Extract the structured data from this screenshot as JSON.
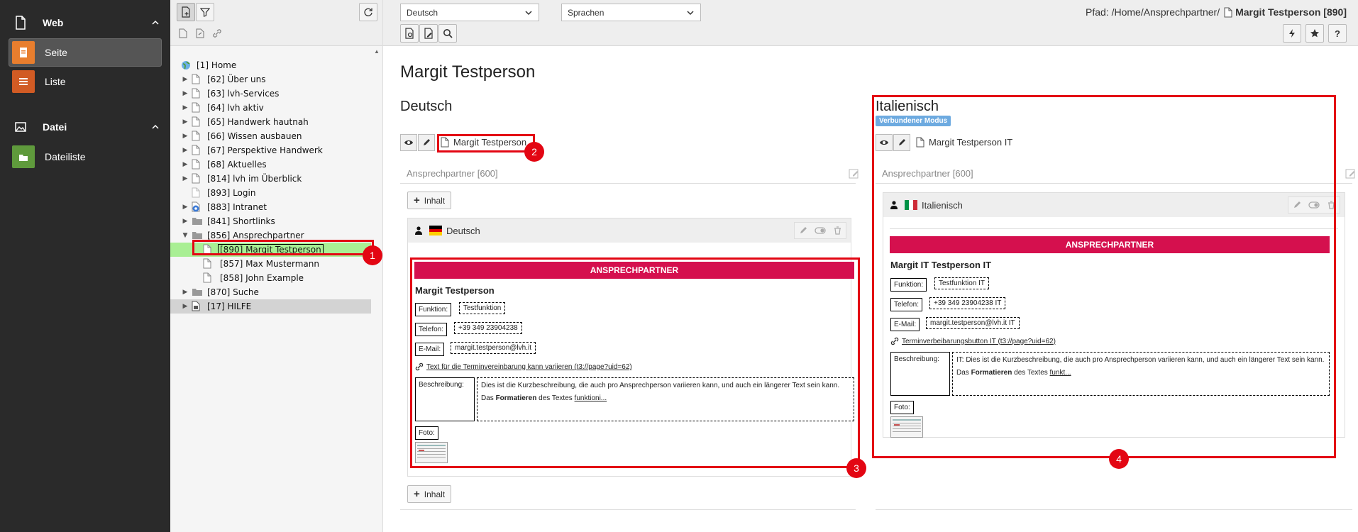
{
  "modules": {
    "groups": [
      {
        "label": "Web",
        "items": [
          "Seite",
          "Liste"
        ]
      },
      {
        "label": "Datei",
        "items": [
          "Dateiliste"
        ]
      }
    ]
  },
  "tree": {
    "nodes": [
      {
        "label": "[1] Home",
        "icon": "globe-icon"
      },
      {
        "label": "[62] Über uns",
        "icon": "page-icon"
      },
      {
        "label": "[63] lvh-Services",
        "icon": "page-icon"
      },
      {
        "label": "[64] lvh aktiv",
        "icon": "page-icon"
      },
      {
        "label": "[65] Handwerk hautnah",
        "icon": "page-icon"
      },
      {
        "label": "[66] Wissen ausbauen",
        "icon": "page-icon"
      },
      {
        "label": "[67] Perspektive Handwerk",
        "icon": "page-icon"
      },
      {
        "label": "[68] Aktuelles",
        "icon": "page-icon"
      },
      {
        "label": "[814] lvh im Überblick",
        "icon": "page-icon"
      },
      {
        "label": "[893] Login",
        "icon": "page-icon"
      },
      {
        "label": "[883] Intranet",
        "icon": "intranet-icon"
      },
      {
        "label": "[841] Shortlinks",
        "icon": "folder-icon"
      },
      {
        "label": "[856] Ansprechpartner",
        "icon": "folder-icon"
      },
      {
        "label": "[890] Margit Testperson",
        "icon": "page-icon"
      },
      {
        "label": "[857] Max Mustermann",
        "icon": "page-icon"
      },
      {
        "label": "[858] John Example",
        "icon": "page-icon"
      },
      {
        "label": "[870] Suche",
        "icon": "folder-icon"
      },
      {
        "label": "[17] HILFE",
        "icon": "help-page-icon"
      }
    ]
  },
  "header": {
    "language_select": "Deutsch",
    "languages_select": "Sprachen",
    "path_label": "Pfad: /Home/Ansprechpartner/",
    "page_title": "Margit Testperson [890]"
  },
  "content": {
    "page_heading": "Margit Testperson",
    "connected_mode_badge": "Verbundener Modus",
    "add_content_label": "Inhalt",
    "columns": [
      {
        "language": "Deutsch",
        "page_title": "Margit Testperson",
        "column_header": "Ansprechpartner [600]",
        "element_label": "Deutsch",
        "banner": "ANSPRECHPARTNER",
        "name": "Margit Testperson",
        "funktion_label": "Funktion:",
        "funktion": "Testfunktion",
        "telefon_label": "Telefon:",
        "telefon": "+39 349 23904238",
        "email_label": "E-Mail:",
        "email": "margit.testperson@lvh.it",
        "link_text": "Text für die Terminvereinbarung kann variieren (t3://page?uid=62)",
        "beschreibung_label": "Beschreibung:",
        "beschreibung": "Dies ist die Kurzbeschreibung, die auch pro Ansprechperson variieren kann, und auch ein längerer Text sein kann.",
        "desc2_a": "Das ",
        "desc2_b": "Formatieren",
        "desc2_c": " des Textes ",
        "desc2_d": "funktioni...",
        "foto_label": "Foto:"
      },
      {
        "language": "Italienisch",
        "page_title": "Margit Testperson IT",
        "column_header": "Ansprechpartner [600]",
        "element_label": "Italienisch",
        "banner": "ANSPRECHPARTNER",
        "name": "Margit IT Testperson IT",
        "funktion_label": "Funktion:",
        "funktion": "Testfunktion IT",
        "telefon_label": "Telefon:",
        "telefon": "+39 349 23904238 IT",
        "email_label": "E-Mail:",
        "email": "margit.testperson@lvh.it IT",
        "link_text": "Terminverbeibarungsbutton IT (t3://page?uid=62)",
        "beschreibung_label": "Beschreibung:",
        "beschreibung": "IT: Dies ist die Kurzbeschreibung, die auch pro Ansprechperson variieren kann, und auch ein längerer Text sein kann.",
        "desc2_a": "Das ",
        "desc2_b": "Formatieren",
        "desc2_c": " des Textes ",
        "desc2_d": "funkt...",
        "foto_label": "Foto:"
      }
    ]
  },
  "markers": [
    "1",
    "2",
    "3",
    "4"
  ],
  "colors": {
    "accent": "#e30613",
    "banner": "#d5104e",
    "selection": "#a9ef94",
    "badge": "#6daae0"
  }
}
